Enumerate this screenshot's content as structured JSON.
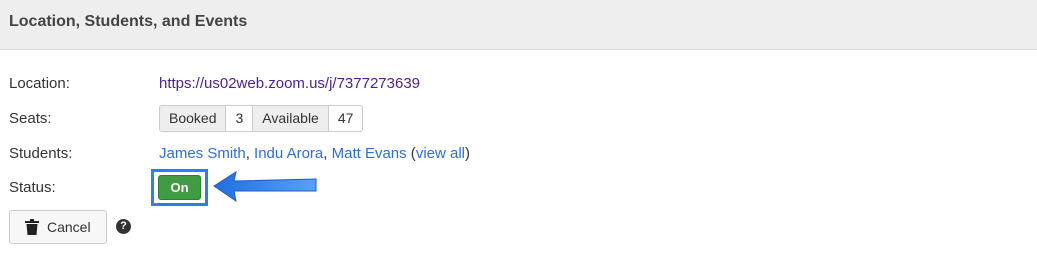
{
  "panel": {
    "title": "Location, Students, and Events"
  },
  "rows": {
    "location_label": "Location:",
    "location_url": "https://us02web.zoom.us/j/7377273639",
    "seats_label": "Seats:",
    "students_label": "Students:",
    "status_label": "Status:"
  },
  "seats": {
    "booked_label": "Booked",
    "booked_count": "3",
    "available_label": "Available",
    "available_count": "47"
  },
  "students": {
    "names": [
      "James Smith",
      "Indu Arora",
      "Matt Evans"
    ],
    "separator": ", ",
    "open_paren": " (",
    "view_all": "view all",
    "close_paren": ")"
  },
  "status": {
    "toggle_label": "On",
    "toggle_color": "#3f9c43",
    "highlight_color": "#2a7ef0"
  },
  "actions": {
    "cancel_label": "Cancel",
    "cancel_icon": "trash-icon",
    "help_icon": "question-circle-icon",
    "help_glyph": "?"
  }
}
